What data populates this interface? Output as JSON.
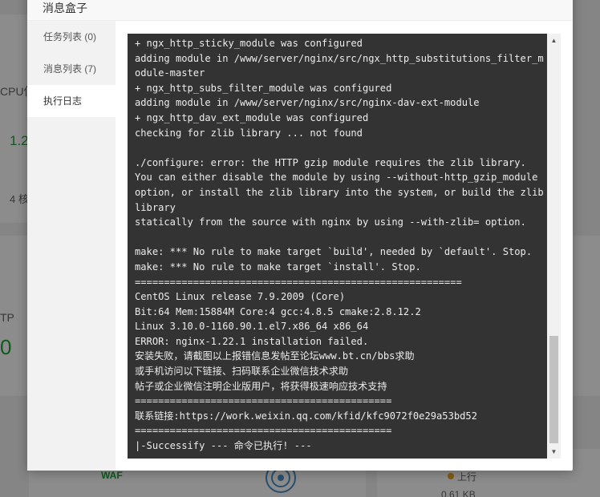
{
  "background": {
    "cpu_label": "CPU使",
    "cpu_value": "1.2",
    "cpu_cores": "4 核",
    "http_label": "TP",
    "http_value": "0",
    "waf_label": "WAF",
    "upload_label": "上行",
    "upload_value": "0.61 KB"
  },
  "modal": {
    "title": "消息盒子",
    "sidebar": [
      {
        "label": "任务列表 (0)",
        "active": false
      },
      {
        "label": "消息列表 (7)",
        "active": false
      },
      {
        "label": "执行日志",
        "active": true
      }
    ],
    "log_lines": [
      "+ ngx_http_sticky_module was configured",
      "adding module in /www/server/nginx/src/ngx_http_substitutions_filter_m",
      "odule-master",
      "+ ngx_http_subs_filter_module was configured",
      "adding module in /www/server/nginx/src/nginx-dav-ext-module",
      "+ ngx_http_dav_ext_module was configured",
      "checking for zlib library ... not found",
      "",
      "./configure: error: the HTTP gzip module requires the zlib library.",
      "You can either disable the module by using --without-http_gzip_module",
      "option, or install the zlib library into the system, or build the zlib",
      "library",
      "statically from the source with nginx by using --with-zlib= option.",
      "",
      "make: *** No rule to make target `build', needed by `default'. Stop.",
      "make: *** No rule to make target `install'. Stop.",
      "========================================================",
      "CentOS Linux release 7.9.2009 (Core)",
      "Bit:64 Mem:15884M Core:4 gcc:4.8.5 cmake:2.8.12.2",
      "Linux 3.10.0-1160.90.1.el7.x86_64 x86_64",
      "ERROR: nginx-1.22.1 installation failed.",
      "安装失败，请截图以上报错信息发帖至论坛www.bt.cn/bbs求助",
      "或手机访问以下链接、扫码联系企业微信技术求助",
      "帖子或企业微信注明企业版用户，将获得极速响应技术支持",
      "============================================",
      "联系链接:https://work.weixin.qq.com/kfid/kfc9072f0e29a53bd52",
      "============================================",
      "|-Successify --- 命令已执行! ---"
    ]
  }
}
